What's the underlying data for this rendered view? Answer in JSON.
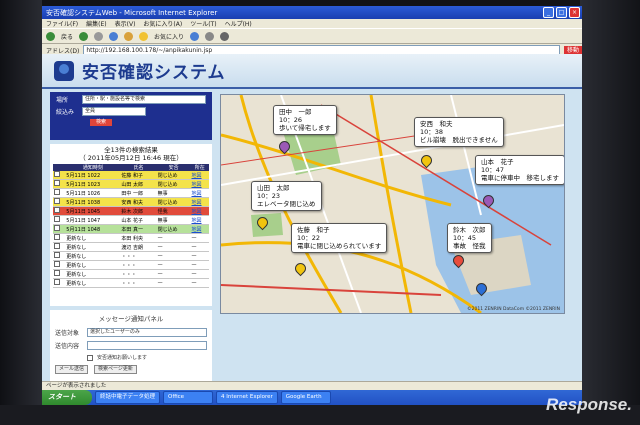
{
  "window": {
    "title": "安否確認システムWeb - Microsoft Internet Explorer",
    "controls": [
      "_",
      "□",
      "×"
    ]
  },
  "menu": [
    "ファイル(F)",
    "編集(E)",
    "表示(V)",
    "お気に入り(A)",
    "ツール(T)",
    "ヘルプ(H)"
  ],
  "toolbar": {
    "back": "戻る",
    "favorites": "お気に入り"
  },
  "address": {
    "label": "アドレス(D)",
    "url": "http://192.168.100.178/~/anpikakunin.jsp",
    "go": "移動"
  },
  "app": {
    "title": "安否確認システム"
  },
  "search": {
    "location_label": "場所",
    "location_value": "住所・駅・施設名等で検索",
    "filter_label": "絞込み",
    "filter_value": "全員",
    "button": "検索"
  },
  "results": {
    "title": "全13件の検索結果",
    "datetime": "（ 2011年05月12日  16:46  現在）",
    "headers": [
      "通知時刻",
      "氏名",
      "安否",
      "所在"
    ],
    "rows": [
      {
        "time": "5月11日 1022",
        "name": "佐藤 和子",
        "status": "閉じ込め",
        "loc": "地図",
        "bg": "#f4e34a"
      },
      {
        "time": "5月11日 1023",
        "name": "山田 太郎",
        "status": "閉じ込め",
        "loc": "地図",
        "bg": "#f4e34a"
      },
      {
        "time": "5月11日 1026",
        "name": "田中 一郎",
        "status": "無事",
        "loc": "地図",
        "bg": "#ffffff"
      },
      {
        "time": "5月11日 1038",
        "name": "安西 和夫",
        "status": "閉じ込め",
        "loc": "地図",
        "bg": "#f4e34a"
      },
      {
        "time": "5月11日 1045",
        "name": "鈴木 次郎",
        "status": "怪我",
        "loc": "地図",
        "bg": "#e14b3b"
      },
      {
        "time": "5月11日 1047",
        "name": "山本 花子",
        "status": "無事",
        "loc": "地図",
        "bg": "#ffffff"
      },
      {
        "time": "5月11日 1048",
        "name": "本田 真一",
        "status": "閉じ込め",
        "loc": "地図",
        "bg": "#b6e19a"
      },
      {
        "time": "更新なし",
        "name": "本田 利央",
        "status": "—",
        "loc": "—",
        "bg": "#ffffff"
      },
      {
        "time": "更新なし",
        "name": "渡辺 吉朗",
        "status": "—",
        "loc": "—",
        "bg": "#ffffff"
      },
      {
        "time": "更新なし",
        "name": "・・・",
        "status": "—",
        "loc": "—",
        "bg": "#ffffff"
      },
      {
        "time": "更新なし",
        "name": "・・・",
        "status": "—",
        "loc": "—",
        "bg": "#ffffff"
      },
      {
        "time": "更新なし",
        "name": "・・・",
        "status": "—",
        "loc": "—",
        "bg": "#ffffff"
      },
      {
        "time": "更新なし",
        "name": "・・・",
        "status": "—",
        "loc": "—",
        "bg": "#ffffff"
      }
    ]
  },
  "message_panel": {
    "title": "メッセージ通知パネル",
    "target_label": "送信対象",
    "target_value": "選択したユーザーのみ",
    "content_label": "送信内容",
    "option": "安否通知お願いします",
    "send_button": "メール送信",
    "update_button": "検索ページ更新"
  },
  "map": {
    "callouts": [
      {
        "name": "田中　一郎",
        "time": "10：26",
        "msg": "歩いて帰宅します"
      },
      {
        "name": "安西　和夫",
        "time": "10：38",
        "msg": "ビル崩壊　脱出できません"
      },
      {
        "name": "山本　花子",
        "time": "10：47",
        "msg": "電車に停車中　移宅します"
      },
      {
        "name": "山田　太郎",
        "time": "10：23",
        "msg": "エレベータ閉じ込め"
      },
      {
        "name": "佐藤　和子",
        "time": "10：22",
        "msg": "電車に閉じ込められています"
      },
      {
        "name": "鈴木　次郎",
        "time": "10：45",
        "msg": "事故　怪我"
      }
    ],
    "copyright": "©2011 ZENRIN DataCom ©2011 ZENRIN"
  },
  "status": {
    "text": "ページが表示されました"
  },
  "taskbar": {
    "start": "スタート",
    "tasks": [
      "終話中電子データ処理",
      "Office",
      "4 Internet Explorer",
      "Google Earth"
    ]
  },
  "watermark": "Response."
}
